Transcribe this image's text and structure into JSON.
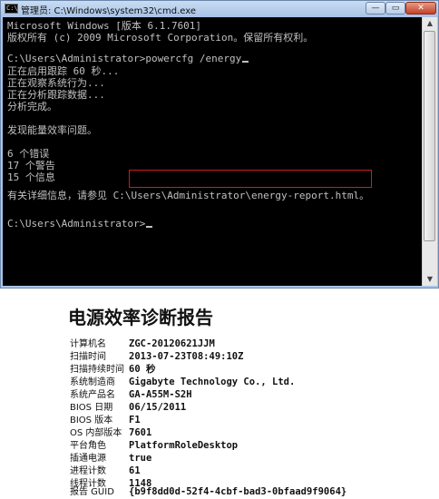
{
  "window": {
    "title": "管理员: C:\\Windows\\system32\\cmd.exe",
    "icon_text": "C:\\",
    "minimize": "—",
    "maximize": "▭",
    "close": "✕"
  },
  "console": {
    "lines": [
      "Microsoft Windows [版本 6.1.7601]",
      "版权所有 (c) 2009 Microsoft Corporation。保留所有权利。",
      "C:\\Users\\Administrator>powercfg /energy",
      "正在启用跟踪 60 秒...",
      "正在观察系统行为...",
      "正在分析跟踪数据...",
      "分析完成。",
      "发现能量效率问题。",
      "6 个错误",
      "17 个警告",
      "15 个信息",
      "有关详细信息，请参见 C:\\Users\\Administrator\\energy-report.html。",
      "C:\\Users\\Administrator>"
    ]
  },
  "scrollbar": {
    "up": "▲",
    "down": "▼"
  },
  "report": {
    "title": "电源效率诊断报告",
    "rows": [
      {
        "label": "计算机名",
        "value": "ZGC-20120621JJM"
      },
      {
        "label": "扫描时间",
        "value": "2013-07-23T08:49:10Z"
      },
      {
        "label": "扫描持续时间",
        "value": "60 秒"
      },
      {
        "label": "系统制造商",
        "value": "Gigabyte Technology Co., Ltd."
      },
      {
        "label": "系统产品名",
        "value": "GA-A55M-S2H"
      },
      {
        "label": "BIOS 日期",
        "value": "06/15/2011"
      },
      {
        "label": "BIOS 版本",
        "value": "F1"
      },
      {
        "label": "OS 内部版本",
        "value": "7601"
      },
      {
        "label": "平台角色",
        "value": "PlatformRoleDesktop"
      },
      {
        "label": "插通电源",
        "value": "true"
      },
      {
        "label": "进程计数",
        "value": "61"
      },
      {
        "label": "线程计数",
        "value": "1148"
      },
      {
        "label": "报告 GUID",
        "value": "{b9f8dd0d-52f4-4cbf-bad3-0bfaad9f9064}"
      }
    ]
  }
}
